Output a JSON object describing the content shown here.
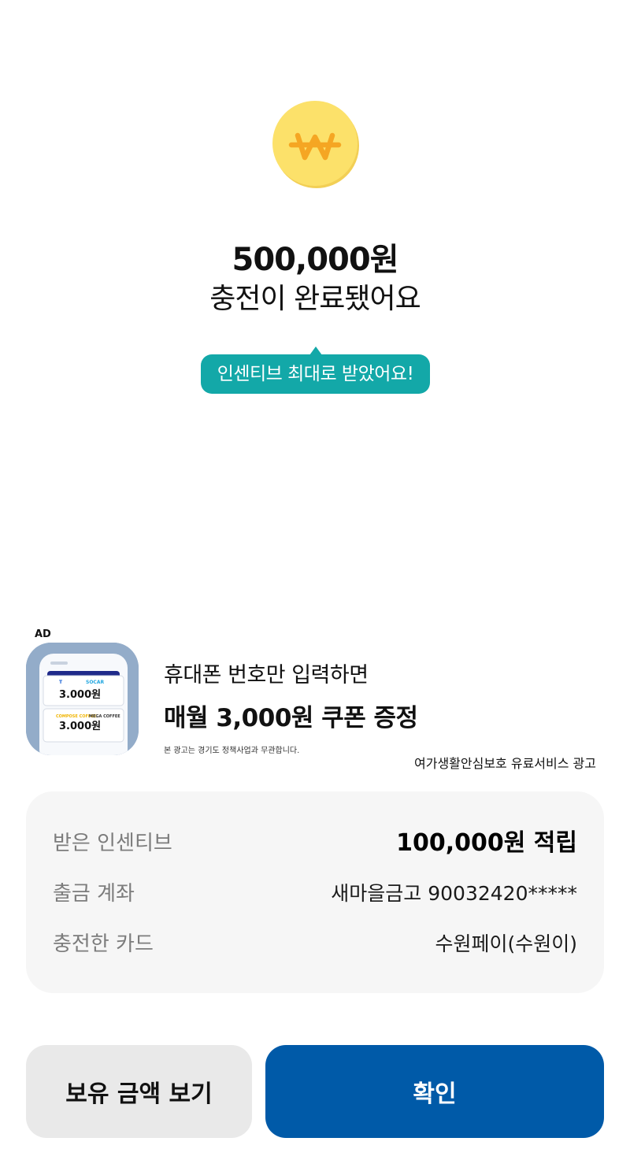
{
  "result": {
    "coin_icon": "won-coin-icon",
    "amount": "500,000원",
    "message": "충전이 완료됐어요",
    "incentive_tip": "인센티브 최대로 받았어요!"
  },
  "ad": {
    "label": "AD",
    "thumbnail_icon": "coupon-phone-icon",
    "thumbnail_texts": {
      "brand_left": "T",
      "brand_top": "SOCAR",
      "coupon_top": "3.000원",
      "brand_bottom_left": "COMPOSE COFFEE",
      "brand_bottom_right": "MEGA COFFEE",
      "coupon_bottom": "3.000원"
    },
    "line1": "휴대폰 번호만 입력하면",
    "line2": "매월 3,000원 쿠폰 증정",
    "disclaimer": "본 광고는 경기도 정책사업과 무관합니다.",
    "sponsor": "여가생활안심보호 유료서비스 광고"
  },
  "summary": {
    "rows": [
      {
        "label": "받은 인센티브",
        "value": "100,000원 적립"
      },
      {
        "label": "출금 계좌",
        "value": "새마을금고 90032420*****"
      },
      {
        "label": "충전한 카드",
        "value": "수원페이(수원이)"
      }
    ]
  },
  "buttons": {
    "secondary_label": "보유 금액 보기",
    "primary_label": "확인"
  },
  "colors": {
    "coin": "#fce16a",
    "coin_symbol": "#f5a623",
    "tip_background": "#13a8a8",
    "primary_button": "#005aa8",
    "secondary_button": "#e9e9e9",
    "card_background": "#f6f6f6"
  }
}
